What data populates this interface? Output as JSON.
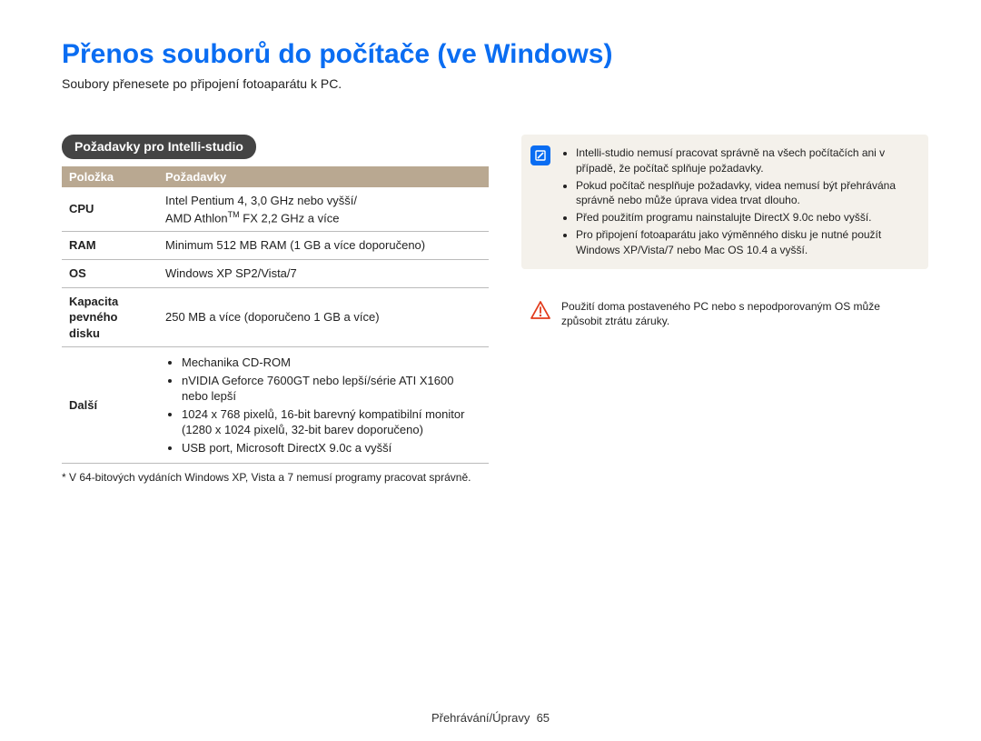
{
  "title": "Přenos souborů do počítače (ve Windows)",
  "subtitle": "Soubory přenesete po připojení fotoaparátu k PC.",
  "section_pill": "Požadavky pro Intelli-studio",
  "table": {
    "header_item": "Položka",
    "header_req": "Požadavky",
    "rows": {
      "cpu_label": "CPU",
      "cpu_line1": "Intel Pentium 4, 3,0 GHz nebo vyšší/",
      "cpu_line2a": "AMD Athlon",
      "cpu_line2_tm": "TM",
      "cpu_line2b": " FX 2,2 GHz a více",
      "ram_label": "RAM",
      "ram_value": "Minimum 512 MB RAM (1 GB a více doporučeno)",
      "os_label": "OS",
      "os_value": "Windows XP SP2/Vista/7",
      "hdd_label": "Kapacita pevného disku",
      "hdd_value": "250 MB a více (doporučeno 1 GB a více)",
      "other_label": "Další",
      "other_items": {
        "0": "Mechanika CD-ROM",
        "1": "nVIDIA Geforce 7600GT nebo lepší/série ATI X1600 nebo lepší",
        "2": "1024 x 768 pixelů, 16-bit barevný kompatibilní monitor (1280 x 1024 pixelů, 32-bit barev doporučeno)",
        "3": "USB port, Microsoft DirectX 9.0c a vyšší"
      }
    }
  },
  "footnote": "* V 64-bitových vydáních Windows XP, Vista a 7 nemusí programy pracovat správně.",
  "info_box": {
    "items": {
      "0": "Intelli-studio nemusí pracovat správně na všech počítačích ani v případě, že počítač splňuje požadavky.",
      "1": "Pokud počítač nesplňuje požadavky, videa nemusí být přehrávána správně nebo může úprava videa trvat dlouho.",
      "2": "Před použitím programu nainstalujte DirectX 9.0c nebo vyšší.",
      "3": "Pro připojení fotoaparátu jako výměnného disku je nutné použít Windows XP/Vista/7 nebo Mac OS 10.4 a vyšší."
    }
  },
  "warn_box": {
    "text": "Použití doma postaveného PC nebo s nepodporovaným OS může způsobit ztrátu záruky."
  },
  "footer": {
    "section": "Přehrávání/Úpravy",
    "page": "65"
  }
}
